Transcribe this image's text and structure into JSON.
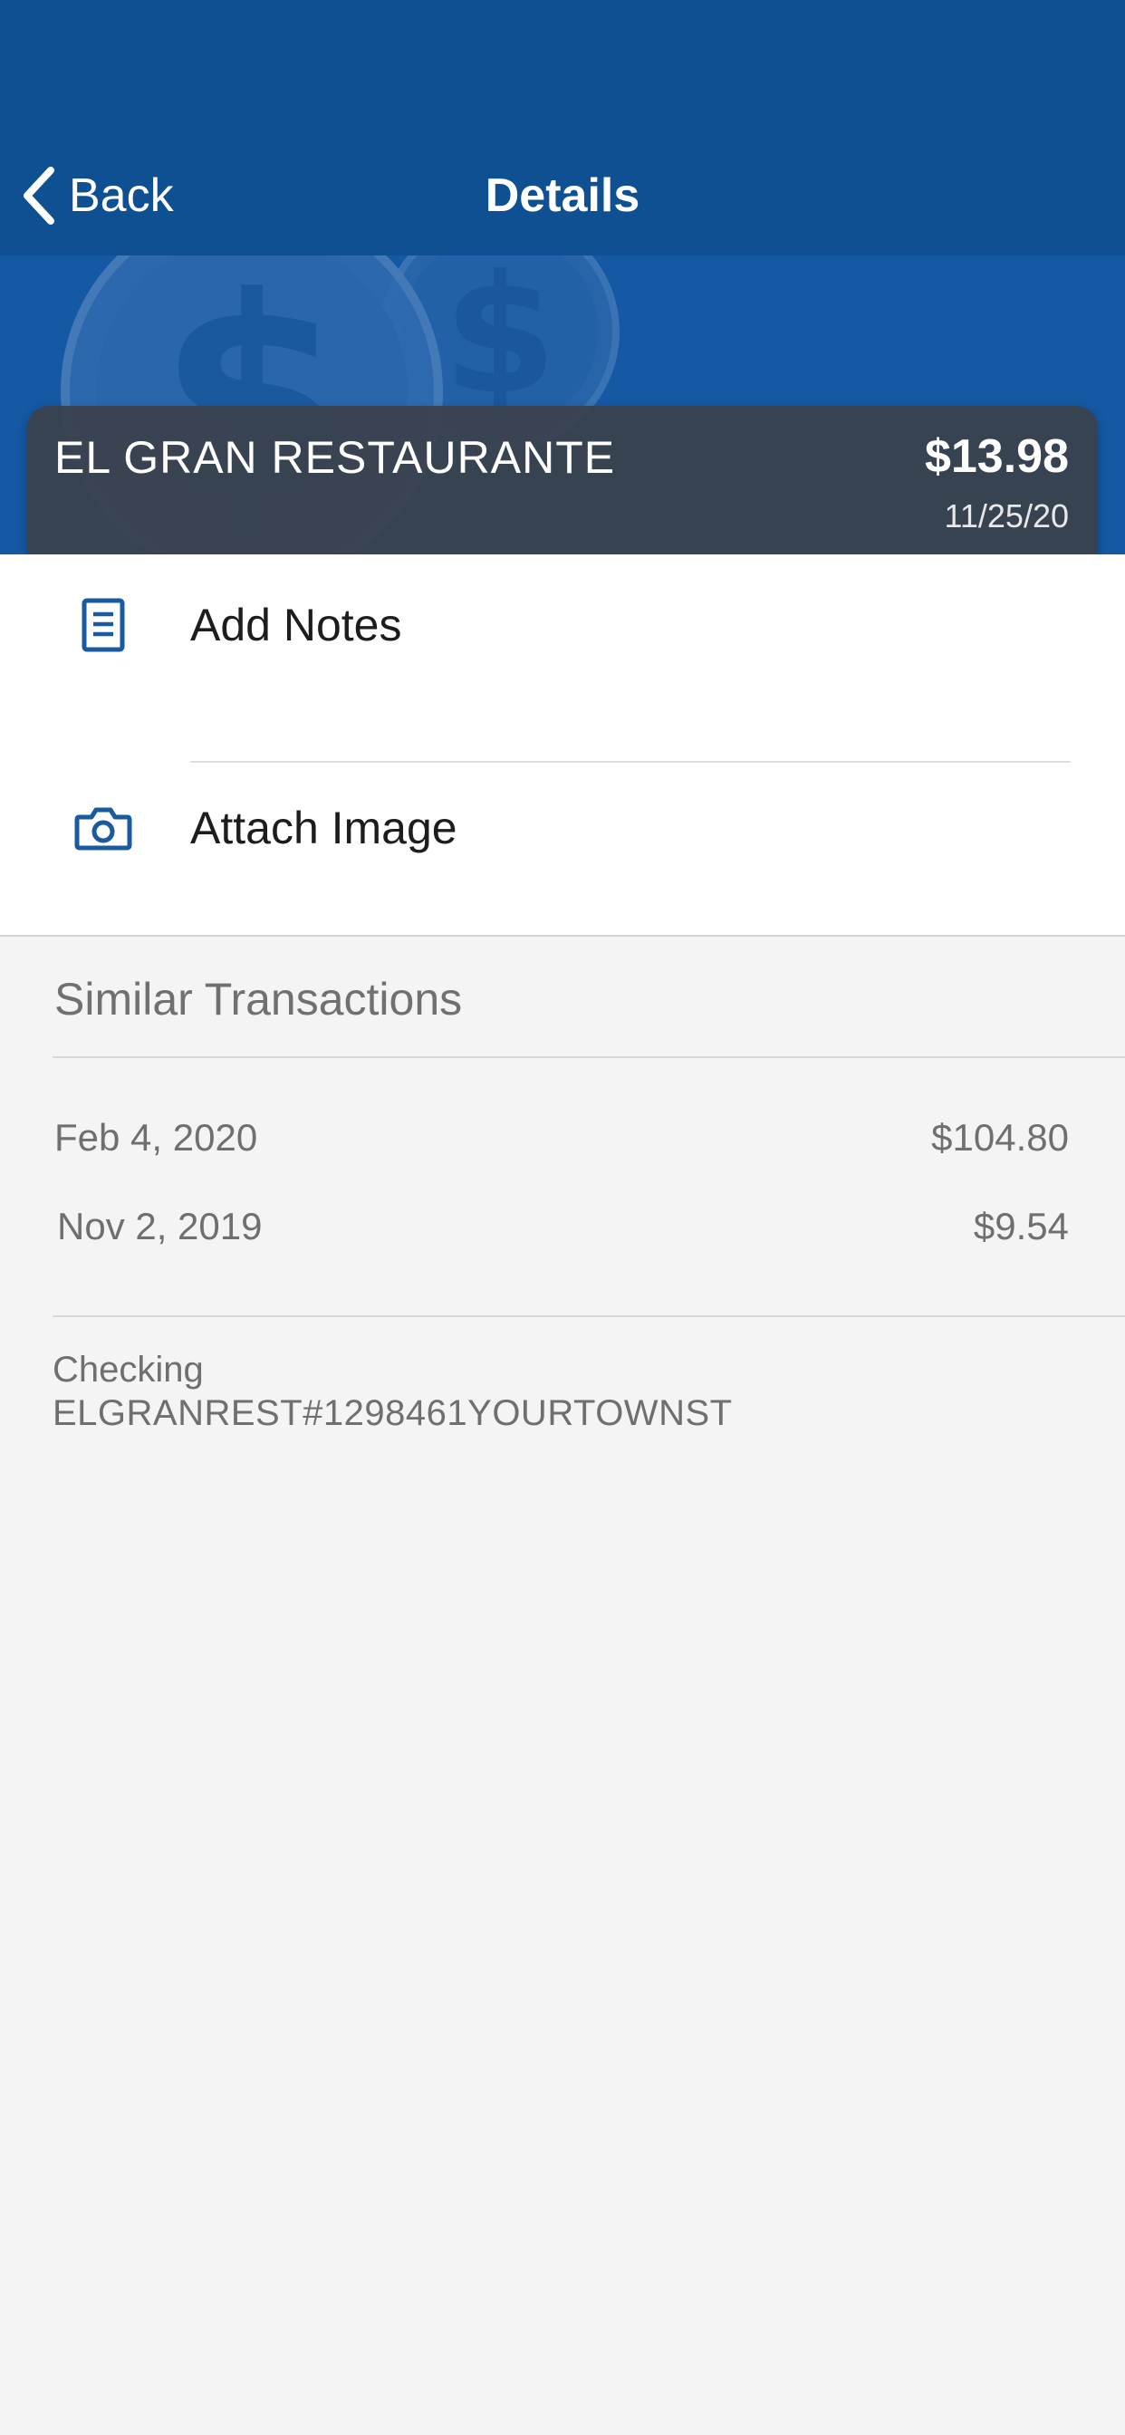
{
  "nav": {
    "back_label": "Back",
    "title": "Details"
  },
  "transaction": {
    "merchant": "EL GRAN RESTAURANTE",
    "amount": "$13.98",
    "date": "11/25/20"
  },
  "actions": [
    {
      "label": "Add Notes",
      "icon": "notes-icon"
    },
    {
      "label": "Attach Image",
      "icon": "camera-icon"
    }
  ],
  "similar": {
    "title": "Similar Transactions",
    "items": [
      {
        "date": "Feb 4, 2020",
        "amount": "$104.80"
      },
      {
        "date": "Nov 2, 2019",
        "amount": "$9.54"
      }
    ]
  },
  "account": {
    "name": "Checking",
    "description": "ELGRANREST#1298461YOURTOWNST"
  },
  "colors": {
    "nav_background": "#0f5093",
    "banner_background": "#1558a3",
    "card_background": "#3a424e",
    "icon_blue": "#1a5aa0",
    "page_background": "#f4f4f4"
  }
}
